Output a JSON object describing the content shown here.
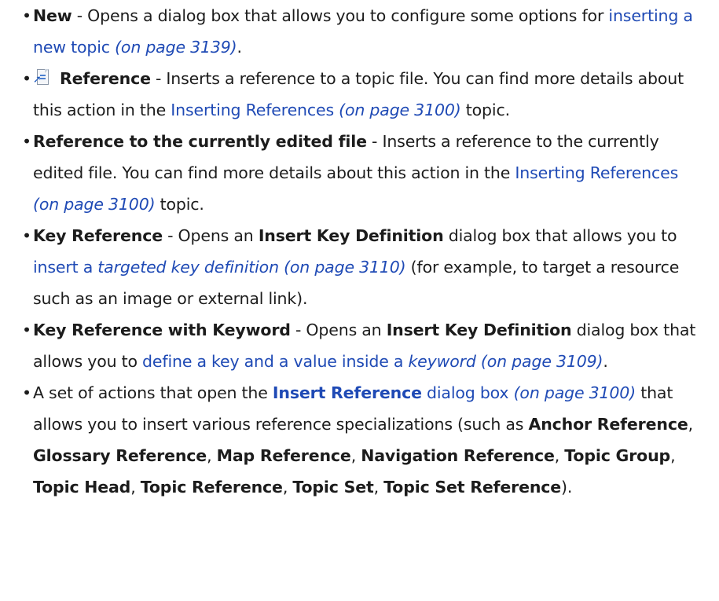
{
  "items": [
    {
      "term": "New",
      "text1": " - Opens a dialog box that allows you to configure some options for ",
      "link": "inserting a new topic",
      "page": " (on page 3139)",
      "text2": "."
    },
    {
      "icon": "reference-icon",
      "term": "Reference",
      "text1": " - Inserts a reference to a topic file. You can find more details about this action in the ",
      "link": "Inserting References",
      "page": " (on page 3100)",
      "text2": " topic."
    },
    {
      "term": "Reference to the currently edited file",
      "text1": " - Inserts a reference to the currently edited file. You can find more details about this action in the ",
      "link": "Inserting References",
      "page": " (on page 3100)",
      "text2": " topic."
    },
    {
      "term": "Key Reference",
      "text1": " - Opens an ",
      "dialog": "Insert Key Definition",
      "text2": " dialog box that allows you to ",
      "link": "insert a ",
      "link_italic": "targeted key definition (on page 3110)",
      "text3": " (for example, to target a resource such as an image or external link)."
    },
    {
      "term": "Key Reference with Keyword",
      "text1": " - Opens an ",
      "dialog": "Insert Key Definition",
      "text2": " dialog box that allows you to ",
      "link": "define a key and a value inside a ",
      "link_italic": "keyword (on page 3109)",
      "text3": "."
    },
    {
      "text1": "A set of actions that open the ",
      "link_bold": "Insert Reference",
      "link": " dialog box",
      "page": " (on page 3100)",
      "text2": " that allows you to insert various reference specializations (such as ",
      "specializations": [
        "Anchor Reference",
        "Glossary Reference",
        "Map Reference",
        "Navigation Reference",
        "Topic Group",
        "Topic Head",
        "Topic Reference",
        "Topic Set",
        "Topic Set Reference"
      ],
      "separator": ", ",
      "text3": ")."
    }
  ]
}
